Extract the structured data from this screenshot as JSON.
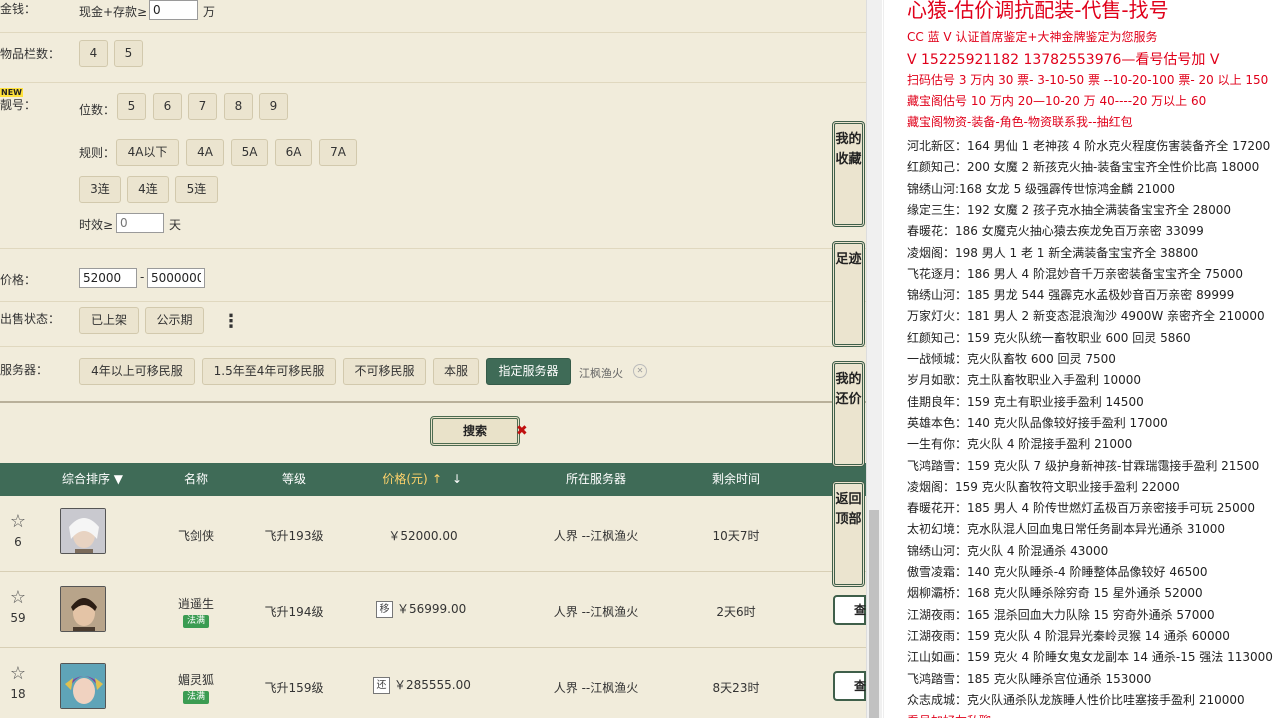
{
  "filters": {
    "money": {
      "label": "金钱：",
      "prefix": "现金+存款≥",
      "value": "0",
      "unit": "万"
    },
    "inventory": {
      "label": "物品栏数：",
      "options": [
        "4",
        "5"
      ]
    },
    "account": {
      "label": "靓号：",
      "new_badge": "NEW",
      "digits_label": "位数：",
      "digits": [
        "5",
        "6",
        "7",
        "8",
        "9"
      ],
      "rules_label": "规则：",
      "rules": [
        "4A以下",
        "4A",
        "5A",
        "6A",
        "7A"
      ],
      "consecutive": [
        "3连",
        "4连",
        "5连"
      ],
      "valid_label": "时效≥",
      "valid_value": "0",
      "valid_unit": "天"
    },
    "price": {
      "label": "价格：",
      "min": "52000",
      "sep": "-",
      "max": "5000000"
    },
    "sale_status": {
      "label": "出售状态：",
      "options": [
        "已上架",
        "公示期"
      ],
      "more": "⋮"
    },
    "server": {
      "label": "服务器：",
      "options": [
        "4年以上可移民服",
        "1.5年至4年可移民服",
        "不可移民服",
        "本服",
        "指定服务器"
      ],
      "active": "指定服务器",
      "chip": "江枫渔火",
      "chip_close": "✕"
    },
    "search_button": "搜索",
    "search_close": "✖"
  },
  "table": {
    "headers": {
      "sort": "综合排序 ▼",
      "name": "名称",
      "level": "等级",
      "price": "价格(元)",
      "price_up": "↑",
      "price_down": "↓",
      "server": "所在服务器",
      "time": "剩余时间"
    },
    "rows": [
      {
        "count": "6",
        "name": "飞剑侠",
        "badge": "",
        "level": "飞升193级",
        "tag": "",
        "price": "￥52000.00",
        "server": "人界 --江枫渔火",
        "time": "10天7时"
      },
      {
        "count": "59",
        "name": "逍遥生",
        "badge": "法满",
        "level": "飞升194级",
        "tag": "移",
        "price": "￥56999.00",
        "server": "人界 --江枫渔火",
        "time": "2天6时",
        "view": "查"
      },
      {
        "count": "18",
        "name": "媚灵狐",
        "badge": "法满",
        "level": "飞升159级",
        "tag": "还",
        "price": "￥285555.00",
        "server": "人界 --江枫渔火",
        "time": "8天23时",
        "view": "查"
      }
    ]
  },
  "side_tabs": [
    "我的收藏",
    "足迹",
    "我的还价",
    "返回顶部"
  ],
  "right_panel": {
    "title": "心猿-估价调抗配装-代售-找号",
    "lines_red": [
      "CC 蓝 V 认证首席鉴定+大神金牌鉴定为您服务",
      "V 15225921182     13782553976—看号估号加 V",
      "扫码估号 3 万内 30 票- 3-10-50 票 --10-20-100 票- 20 以上 150",
      "藏宝阁估号 10 万内 20—10-20 万 40----20 万以上 60",
      "藏宝阁物资-装备-角色-物资联系我--抽红包"
    ],
    "lines": [
      "河北新区：164 男仙 1 老神孩 4 阶水克火程度伤害装备齐全 17200",
      "红颜知己：200 女魔 2 新孩克火抽-装备宝宝齐全性价比高 18000",
      "锦绣山河:168 女龙 5 级强霹传世惊鸿金麟 21000",
      "缘定三生：192 女魔 2 孩子克水抽全满装备宝宝齐全 28000",
      "春暖花：186 女魔克火抽心猿去疾龙免百万亲密 33099",
      "凌烟阁：198 男人 1 老 1 新全满装备宝宝齐全 38800",
      "飞花逐月：186 男人 4 阶混妙音千万亲密装备宝宝齐全 75000",
      "锦绣山河：185 男龙 544 强霹克水孟极妙音百万亲密 89999",
      "万家灯火：181 男人 2 新变态混浪淘沙 4900W 亲密齐全 210000",
      "红颜知己：159 克火队统一畜牧职业 600 回灵 5860",
      "一战倾城：克火队畜牧 600 回灵 7500",
      "岁月如歌：克土队畜牧职业入手盈利 10000",
      "佳期良年：159 克土有职业接手盈利 14500",
      "英雄本色：140 克火队品像较好接手盈利 17000",
      "一生有你：克火队 4 阶混接手盈利 21000",
      "飞鸿踏雪：159 克火队 7 级护身新神孩-甘霖瑞霭接手盈利 21500",
      "凌烟阁：159 克火队畜牧符文职业接手盈利 22000",
      "春暖花开：185 男人 4 阶传世燃灯孟极百万亲密接手可玩 25000",
      "太初幻境：克水队混人回血鬼日常任务副本异光通杀 31000",
      "锦绣山河：克火队 4 阶混通杀 43000",
      "傲雪凌霜：140 克火队睡杀-4 阶睡整体品像较好 46500",
      "烟柳灞桥：168 克火队睡杀除穷奇 15 星外通杀 52000",
      "江湖夜雨：165 混杀回血大力队除 15 穷奇外通杀 57000",
      "江湖夜雨：159 克火队 4 阶混异光秦岭灵猴 14 通杀 60000",
      "江山如画：159 克火 4 阶睡女鬼女龙副本 14 通杀-15 强法 113000",
      "飞鸿踏雪：185 克火队睡杀宫位通杀 153000",
      "众志成城：克火队通杀队龙族睡人性价比哇塞接手盈利 210000"
    ],
    "footer": "看号加好友私聊"
  }
}
